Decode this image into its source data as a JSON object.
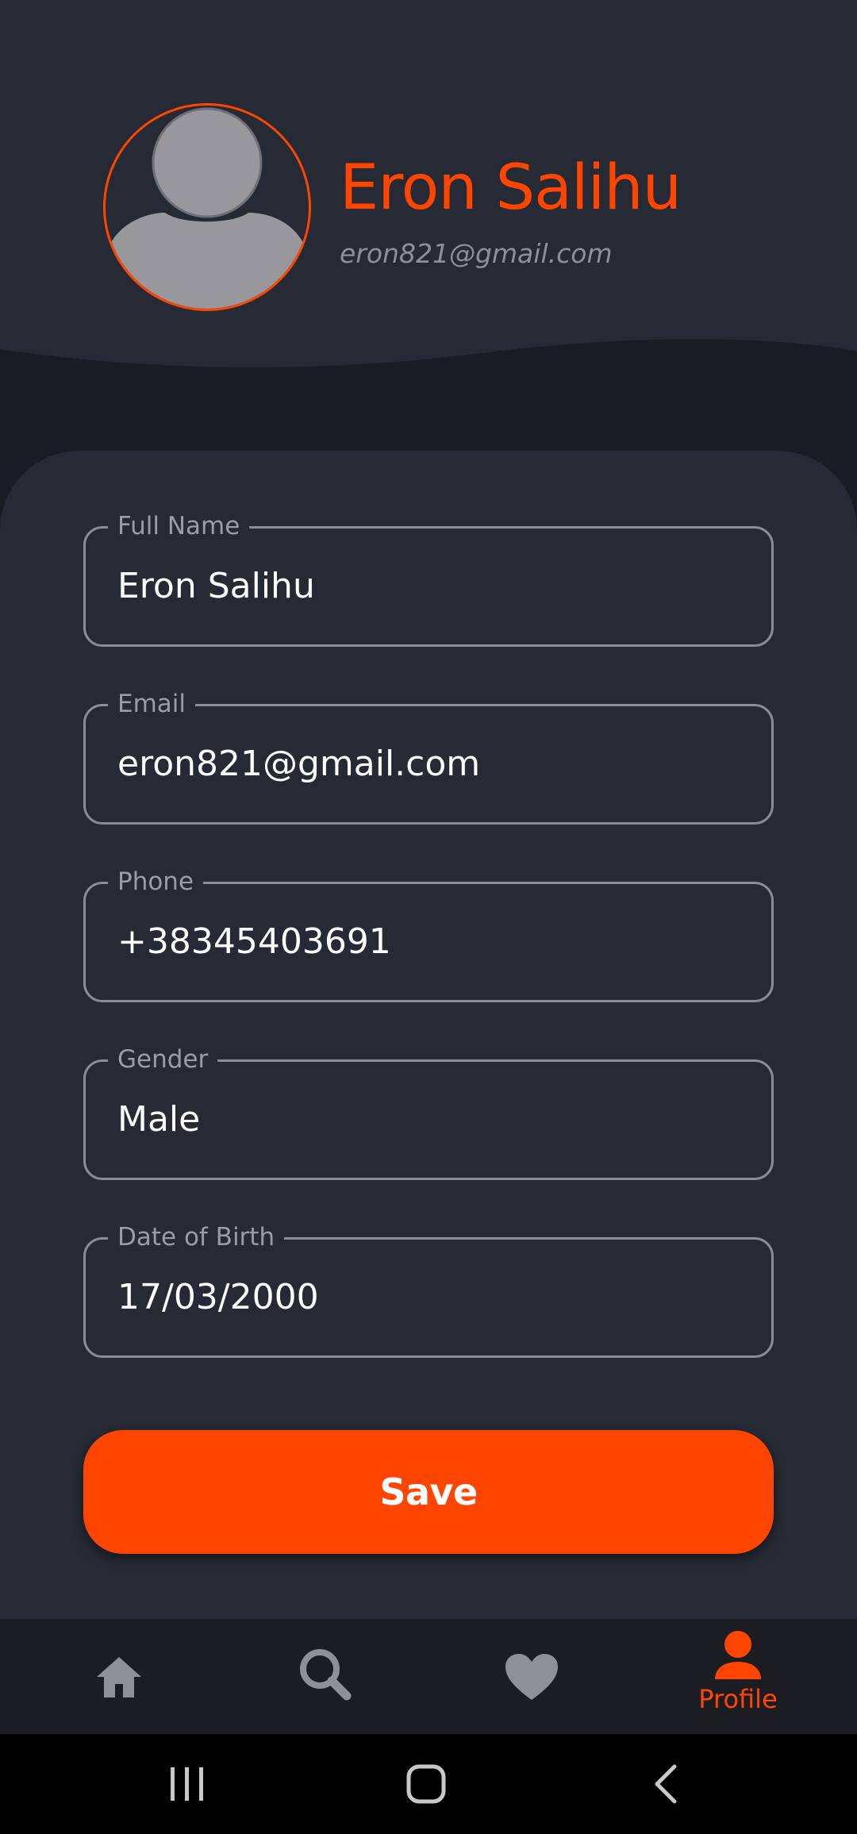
{
  "profile": {
    "name": "Eron Salihu",
    "email": "eron821@gmail.com"
  },
  "form": {
    "fields": [
      {
        "label": "Full Name",
        "value": "Eron Salihu"
      },
      {
        "label": "Email",
        "value": "eron821@gmail.com"
      },
      {
        "label": "Phone",
        "value": "+38345403691"
      },
      {
        "label": "Gender",
        "value": "Male"
      },
      {
        "label": "Date of Birth",
        "value": "17/03/2000"
      }
    ],
    "save_label": "Save"
  },
  "nav": {
    "items": [
      {
        "icon": "home-icon",
        "active": false
      },
      {
        "icon": "search-icon",
        "active": false
      },
      {
        "icon": "heart-icon",
        "active": false
      },
      {
        "icon": "profile-icon",
        "label": "Profile",
        "active": true
      }
    ]
  },
  "system_nav": {
    "icons": [
      "recents-icon",
      "home-icon",
      "back-icon"
    ]
  },
  "colors": {
    "accent": "#ff4500",
    "background": "#1a1c23",
    "surface": "#262a34",
    "muted": "#8f9097",
    "text": "#ffffff"
  }
}
